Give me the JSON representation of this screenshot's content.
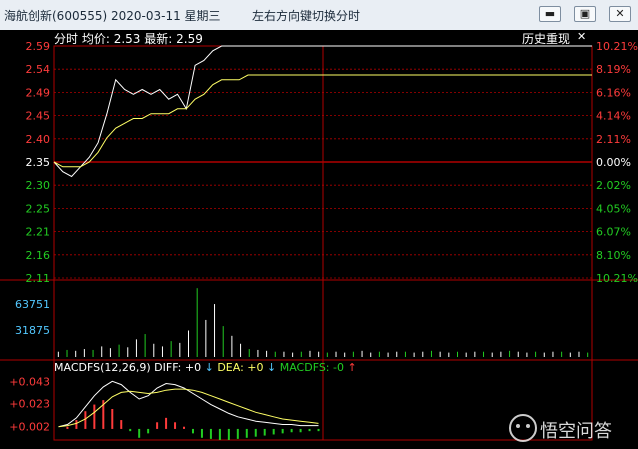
{
  "window": {
    "title": "海航创新(600555)  2020-03-11  星期三",
    "hint": "左右方向键切换分时",
    "buttons": [
      "minimize-icon",
      "restore-icon",
      "close-icon"
    ]
  },
  "header": {
    "mode": "分时",
    "avg_label": "均价:",
    "avg_value": "2.53",
    "last_label": "最新:",
    "last_value": "2.59",
    "history_button": "历史重现",
    "close_glyph": "✕"
  },
  "colors": {
    "up": "#ff3b3b",
    "down": "#22cc22",
    "neutral": "#ffffff",
    "grid": "#b00000",
    "volume_label": "#53c8ff",
    "price_line": "#ffffff",
    "avg_line": "#ffff66"
  },
  "price_axis": {
    "left": [
      "2.59",
      "2.54",
      "2.49",
      "2.45",
      "2.40",
      "2.35",
      "2.30",
      "2.25",
      "2.21",
      "2.16",
      "2.11"
    ],
    "right": [
      "10.21%",
      "8.19%",
      "6.16%",
      "4.14%",
      "2.11%",
      "0.00%",
      "2.02%",
      "4.05%",
      "6.07%",
      "8.10%",
      "10.21%"
    ],
    "prev_close": 2.35,
    "range": [
      2.11,
      2.59
    ]
  },
  "volume_axis": {
    "labels": [
      "63751",
      "31875"
    ]
  },
  "macd": {
    "title": "MACDFS(12,26,9)",
    "diff_label": "DIFF: +0",
    "diff_arrow": "↓",
    "dea_label": "DEA: +0",
    "dea_arrow": "↓",
    "macdfs_label": "MACDFS: -0",
    "macdfs_arrow": "↑",
    "axis": [
      "+0.043",
      "+0.023",
      "+0.002"
    ]
  },
  "watermark": {
    "text": "悟空问答"
  },
  "chart_data": {
    "type": "line",
    "xlabel": "",
    "ylabel": "",
    "ylim": [
      2.11,
      2.59
    ],
    "series": [
      {
        "values": [
          2.35,
          2.33,
          2.32,
          2.34,
          2.36,
          2.39,
          2.45,
          2.52,
          2.5,
          2.49,
          2.5,
          2.49,
          2.5,
          2.48,
          2.49,
          2.46,
          2.55,
          2.56,
          2.58,
          2.59,
          2.59,
          2.59,
          2.59,
          2.59,
          2.59,
          2.59,
          2.59,
          2.59,
          2.59,
          2.59,
          2.59,
          2.59,
          2.59,
          2.59,
          2.59,
          2.59,
          2.59,
          2.59,
          2.59,
          2.59,
          2.59,
          2.59,
          2.59,
          2.59,
          2.59,
          2.59,
          2.59,
          2.59,
          2.59,
          2.59,
          2.59,
          2.59,
          2.59,
          2.59,
          2.59,
          2.59,
          2.59,
          2.59,
          2.59,
          2.59,
          2.59,
          2.59
        ]
      },
      {
        "values": [
          2.35,
          2.34,
          2.34,
          2.34,
          2.35,
          2.37,
          2.4,
          2.42,
          2.43,
          2.44,
          2.44,
          2.45,
          2.45,
          2.45,
          2.46,
          2.46,
          2.48,
          2.49,
          2.51,
          2.52,
          2.52,
          2.52,
          2.53,
          2.53,
          2.53,
          2.53,
          2.53,
          2.53,
          2.53,
          2.53,
          2.53,
          2.53,
          2.53,
          2.53,
          2.53,
          2.53,
          2.53,
          2.53,
          2.53,
          2.53,
          2.53,
          2.53,
          2.53,
          2.53,
          2.53,
          2.53,
          2.53,
          2.53,
          2.53,
          2.53,
          2.53,
          2.53,
          2.53,
          2.53,
          2.53,
          2.53,
          2.53,
          2.53,
          2.53,
          2.53,
          2.53,
          2.53
        ]
      }
    ],
    "volume": [
      6,
      8,
      7,
      9,
      8,
      12,
      10,
      14,
      11,
      20,
      26,
      15,
      12,
      18,
      16,
      30,
      78,
      42,
      60,
      35,
      24,
      15,
      9,
      8,
      7,
      6,
      6,
      5,
      6,
      7,
      6,
      5,
      6,
      5,
      6,
      7,
      5,
      6,
      5,
      6,
      6,
      5,
      6,
      7,
      6,
      5,
      6,
      5,
      6,
      6,
      5,
      6,
      7,
      6,
      5,
      6,
      5,
      6,
      6,
      5,
      6,
      5
    ],
    "volume_ylim": [
      0,
      85000
    ],
    "macd_diff": [
      0.002,
      0.004,
      0.01,
      0.02,
      0.03,
      0.038,
      0.043,
      0.04,
      0.033,
      0.027,
      0.03,
      0.037,
      0.041,
      0.04,
      0.037,
      0.032,
      0.027,
      0.022,
      0.018,
      0.014,
      0.011,
      0.009,
      0.007,
      0.006,
      0.005,
      0.004,
      0.004,
      0.003,
      0.003,
      0.003
    ],
    "macd_dea": [
      0.002,
      0.003,
      0.005,
      0.009,
      0.015,
      0.022,
      0.029,
      0.033,
      0.034,
      0.033,
      0.032,
      0.033,
      0.035,
      0.036,
      0.036,
      0.035,
      0.033,
      0.03,
      0.027,
      0.024,
      0.021,
      0.018,
      0.015,
      0.013,
      0.011,
      0.009,
      0.008,
      0.007,
      0.006,
      0.005
    ],
    "macd_hist": [
      0.0,
      0.002,
      0.008,
      0.016,
      0.022,
      0.026,
      0.018,
      0.008,
      -0.002,
      -0.008,
      -0.004,
      0.006,
      0.01,
      0.006,
      0.002,
      -0.004,
      -0.008,
      -0.009,
      -0.01,
      -0.01,
      -0.009,
      -0.008,
      -0.007,
      -0.006,
      -0.005,
      -0.004,
      -0.003,
      -0.003,
      -0.002,
      -0.002
    ],
    "macd_ylim": [
      -0.01,
      0.046
    ]
  }
}
